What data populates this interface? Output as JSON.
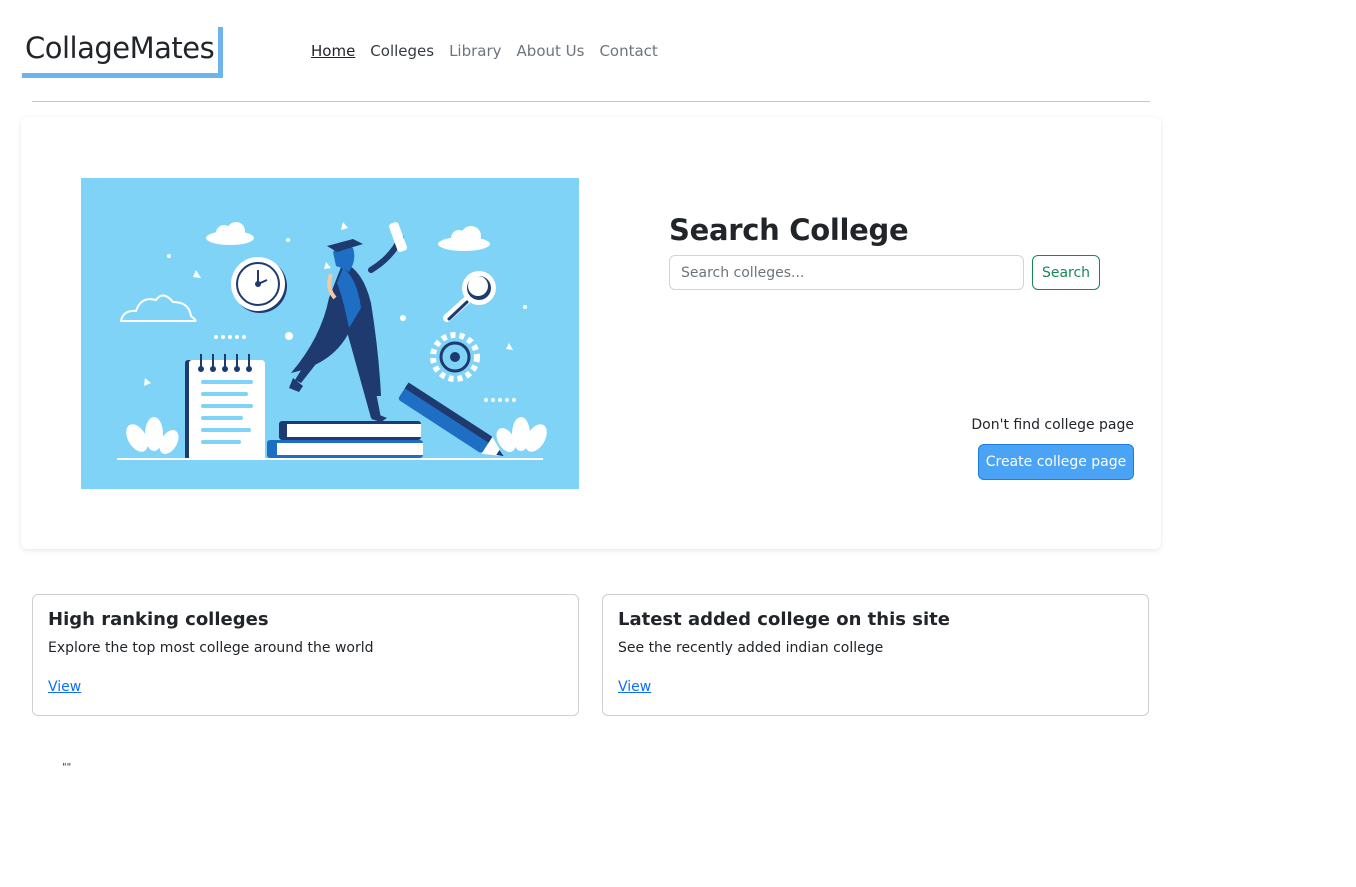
{
  "header": {
    "logo": "CollageMates",
    "nav": [
      {
        "label": "Home"
      },
      {
        "label": "Colleges"
      },
      {
        "label": "Library"
      },
      {
        "label": "About Us"
      },
      {
        "label": "Contact"
      }
    ]
  },
  "hero": {
    "title": "Search College",
    "search_placeholder": "Search colleges...",
    "search_button": "Search",
    "prompt_text": "Don't find college page",
    "create_button": "Create college page"
  },
  "cards": [
    {
      "title": "High ranking colleges",
      "text": "Explore the top most college around the world",
      "link": "View"
    },
    {
      "title": "Latest added college on this site",
      "text": "See the recently added indian college",
      "link": "View"
    }
  ],
  "footer_text": "\"\"",
  "colors": {
    "accent": "#6fb3ec",
    "illustration_bg": "#7fd3f7",
    "primary_button": "#4aa3f5",
    "success": "#198754",
    "link": "#0d6efd"
  }
}
